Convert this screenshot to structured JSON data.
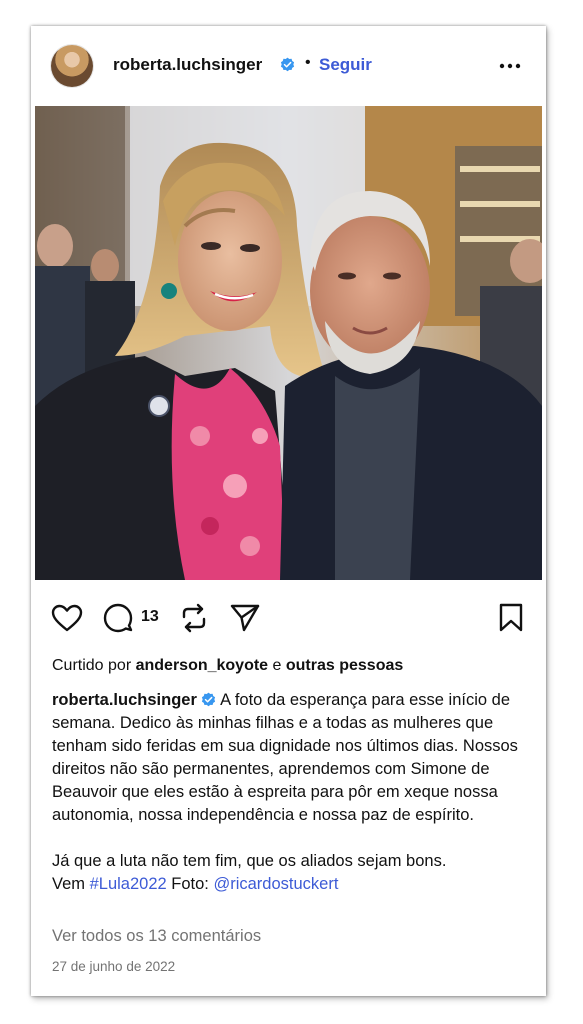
{
  "post": {
    "username": "roberta.luchsinger",
    "separator": "•",
    "follow_label": "Seguir",
    "comment_count": "13",
    "likes": {
      "prefix": "Curtido por ",
      "user": "anderson_koyote",
      "conjunction": " e ",
      "others": "outras pessoas"
    },
    "caption": {
      "username": "roberta.luchsinger",
      "text_1": "A foto da esperança para esse início de semana. Dedico às minhas filhas e a todas as mulheres que tenham sido feridas em sua dignidade nos últimos dias. Nossos direitos não são permanentes, aprendemos com Simone de Beauvoir que eles estão à espreita para pôr em xeque nossa autonomia, nossa independência e nossa paz de espírito.",
      "text_2": "Já que a luta não tem fim, que os aliados sejam bons.",
      "text_3_prefix": "Vem ",
      "hashtag": "#Lula2022",
      "photo_credit_label": " Foto: ",
      "mention": "@ricardostuckert"
    },
    "view_comments": "Ver todos os 13 comentários",
    "date": "27 de junho de 2022"
  },
  "colors": {
    "link_blue": "#3d5bd6",
    "verified_blue": "#3897f0",
    "muted_gray": "#737373"
  },
  "icons": [
    "heart-icon",
    "comment-icon",
    "repost-icon",
    "share-icon",
    "bookmark-icon",
    "more-options-icon",
    "verified-badge-icon"
  ]
}
